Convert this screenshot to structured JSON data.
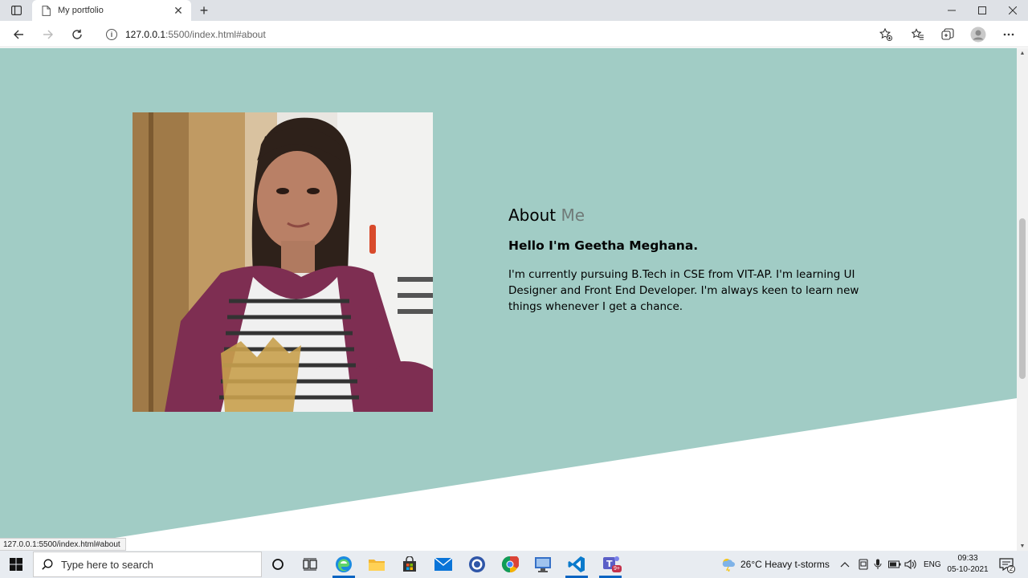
{
  "browser": {
    "tab_title": "My portfolio",
    "url_host": "127.0.0.1",
    "url_path": ":5500/index.html#about",
    "status_url": "127.0.0.1:5500/index.html#about"
  },
  "about": {
    "heading_main": "About",
    "heading_accent": "Me",
    "greeting": "Hello I'm Geetha Meghana.",
    "description": "I'm currently pursuing B.Tech in CSE from VIT-AP. I'm learning UI Designer and Front End Developer. I'm always keen to learn new things whenever I get a chance."
  },
  "colors": {
    "section_bg": "#a1ccc5",
    "accent_text": "#707a78"
  },
  "taskbar": {
    "search_placeholder": "Type here to search",
    "weather": "26°C  Heavy t-storms",
    "language": "ENG",
    "time": "09:33",
    "date": "05-10-2021",
    "teams_badge": "9+",
    "notification_count": "2"
  }
}
